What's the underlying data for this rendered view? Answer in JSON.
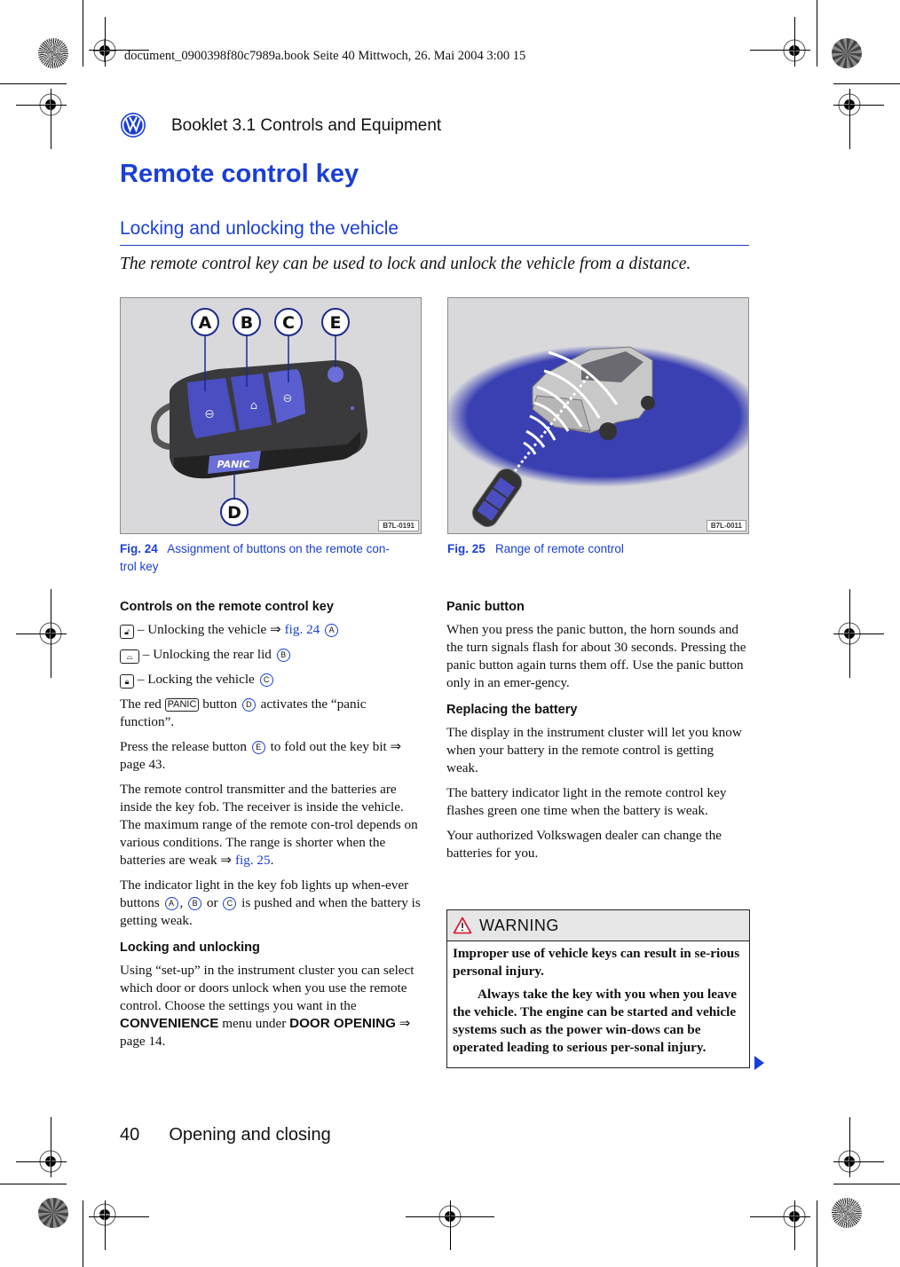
{
  "print_header": "document_0900398f80c7989a.book  Seite 40  Mittwoch, 26. Mai 2004  3:00 15",
  "header": {
    "logo": "vw-logo",
    "booklet": "Booklet 3.1  Controls and Equipment"
  },
  "page_title": "Remote control key",
  "section": {
    "title": "Locking and unlocking the vehicle",
    "intro": "The remote control key can be used to lock and unlock the vehicle from a distance."
  },
  "figures": [
    {
      "label": "Fig. 24",
      "caption": "Assignment of buttons on the remote con-trol key",
      "caption_line1": "Assignment of buttons on the remote con-",
      "caption_line2": "trol key",
      "code": "B7L-0191",
      "callouts": [
        "A",
        "B",
        "C",
        "E",
        "D"
      ],
      "panic_label": "PANIC"
    },
    {
      "label": "Fig. 25",
      "caption": "Range of remote control",
      "code": "B7L-0011"
    }
  ],
  "left_column": {
    "controls_heading": "Controls on the remote control key",
    "items": [
      {
        "icon": "unlock-icon",
        "text": "– Unlocking the vehicle ⇒ ",
        "link": "fig. 24",
        "callout": "A"
      },
      {
        "icon": "rear-lid-icon",
        "text": "– Unlocking the rear lid",
        "callout": "B"
      },
      {
        "icon": "lock-icon",
        "text": "– Locking the vehicle",
        "callout": "C"
      }
    ],
    "panic_pre": "The red",
    "panic_key": "PANIC",
    "panic_mid": "button",
    "panic_callout": "D",
    "panic_post": "activates the “panic function”.",
    "release_pre": "Press the release button",
    "release_callout": "E",
    "release_post": "to fold out the key bit ⇒ page 43.",
    "transmitter_text": "The remote control transmitter and the batteries are inside the key fob. The receiver is inside the vehicle. The maximum range of the remote con-trol depends on various conditions. The range is shorter when the batteries are weak ⇒ ",
    "transmitter_link": "fig. 25",
    "indicator_pre": "The indicator light in the key fob lights up when-ever buttons",
    "indicator_a": "A",
    "indicator_b": "B",
    "indicator_or": "or",
    "indicator_c": "C",
    "indicator_post": "is pushed and when the battery is getting weak.",
    "locking_heading": "Locking and unlocking",
    "locking_pre": "Using “set-up” in the instrument cluster you can select which door or doors unlock when you use the remote control. Choose the settings you want in the",
    "locking_menu": "CONVENIENCE",
    "locking_mid": "menu under",
    "locking_item": "DOOR OPENING",
    "locking_post": "⇒ page 14."
  },
  "right_column": {
    "panic_heading": "Panic button",
    "panic_text": "When you press the panic button, the horn sounds and the turn signals flash for about 30 seconds. Pressing the panic button again turns them off. Use the panic button only in an emer-gency.",
    "battery_heading": "Replacing the battery",
    "battery_p1": "The display in the instrument cluster will let you know when your battery in the remote control is getting weak.",
    "battery_p2": "The battery indicator light in the remote control key flashes green one time when the battery is weak.",
    "battery_p3": "Your authorized Volkswagen dealer can change the batteries for you."
  },
  "warning": {
    "title": "WARNING",
    "lead": "Improper use of vehicle keys can result in se-rious personal injury.",
    "body": "Always take the key with you when you leave the vehicle. The engine can be started and vehicle systems such as the power win-dows can be operated leading to serious per-sonal injury."
  },
  "footer": {
    "page_number": "40",
    "chapter": "Opening and closing"
  },
  "colors": {
    "accent_blue": "#1a3fd6",
    "warning_red": "#d8203a"
  }
}
